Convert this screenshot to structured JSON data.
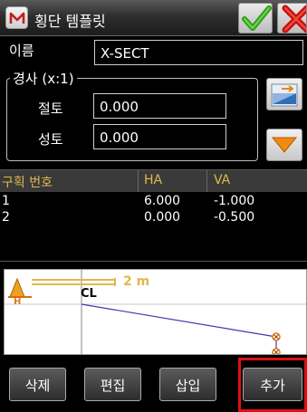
{
  "title_bar": {
    "app_icon": "m-app-icon",
    "title": "횡단 템플릿",
    "ok_icon": "green-check-icon",
    "close_icon": "red-x-icon"
  },
  "name_row": {
    "label": "이름",
    "value": "X-SECT"
  },
  "slope": {
    "legend": "경사 (x:1)",
    "cut_label": "절토",
    "cut_value": "0.000",
    "fill_label": "성토",
    "fill_value": "0.000",
    "swap_icon": "swap-slope-icon",
    "dropdown_icon": "orange-down-triangle-icon"
  },
  "table": {
    "headers": [
      "구획 번호",
      "HA",
      "VA"
    ],
    "rows": [
      [
        "1",
        "6.000",
        "-1.000"
      ],
      [
        "2",
        "0.000",
        "-0.500"
      ]
    ]
  },
  "graphic": {
    "scale_label": "2 m",
    "cl_label": "CL",
    "north_label": "H",
    "colors": {
      "line": "#3b3bb0",
      "point": "#e07a10",
      "scale": "#e0b84a"
    }
  },
  "buttons": {
    "delete": "삭제",
    "edit": "편집",
    "insert": "삽입",
    "add": "추가"
  },
  "colors": {
    "highlight": "#e01010",
    "header_text": "#e0b84a"
  }
}
